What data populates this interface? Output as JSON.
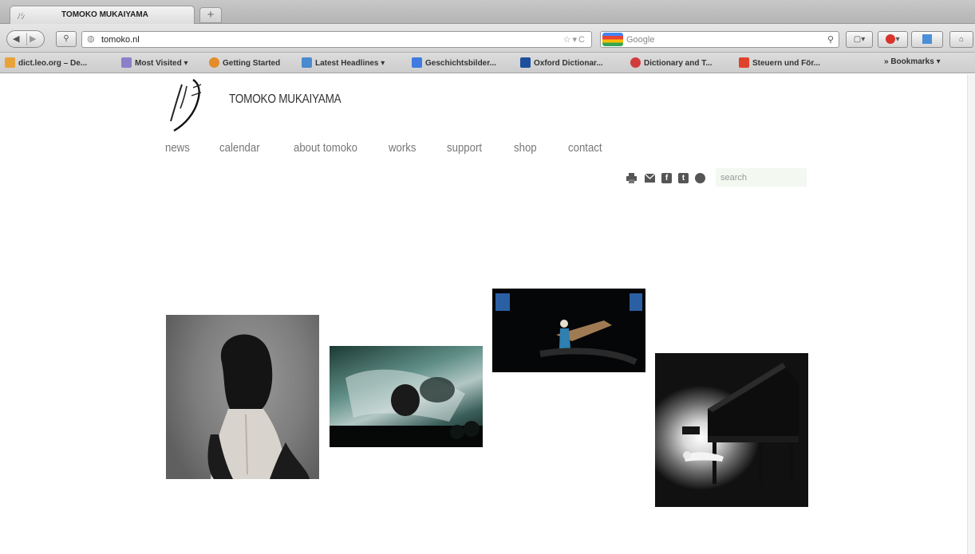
{
  "browser": {
    "tab_title": "TOMOKO MUKAIYAMA",
    "new_tab_symbol": "+",
    "url": "tomoko.nl",
    "search_engine": "Google",
    "bookmarks": [
      {
        "label": "dict.leo.org – De...",
        "color": "#e8a23a"
      },
      {
        "label": "Most Visited ▾",
        "color": "#8c7fc9"
      },
      {
        "label": "Getting Started",
        "color": "#e58b2a"
      },
      {
        "label": "Latest Headlines ▾",
        "color": "#4a8ad0"
      },
      {
        "label": "Geschichtsbilder...",
        "color": "#3f7be0"
      },
      {
        "label": "Oxford Dictionar...",
        "color": "#1e4f9c"
      },
      {
        "label": "Dictionary and T...",
        "color": "#d23b3b"
      },
      {
        "label": "Steuern und För...",
        "color": "#e0432b"
      },
      {
        "label": "» Bookmarks ▾",
        "color": "#555555"
      }
    ]
  },
  "site": {
    "title": "TOMOKO MUKAIYAMA",
    "menu": [
      "news",
      "calendar",
      "about tomoko",
      "works",
      "support",
      "shop",
      "contact"
    ],
    "search_placeholder": "search",
    "share_icons": [
      "print-icon",
      "mail-icon",
      "facebook-icon",
      "twitter-icon",
      "smiley-icon"
    ],
    "facebook_glyph": "f",
    "twitter_glyph": "t"
  },
  "gallery": [
    {
      "name": "photo-woman-back"
    },
    {
      "name": "photo-projection-performance"
    },
    {
      "name": "photo-stage-performer"
    },
    {
      "name": "photo-piano-spotlight"
    }
  ]
}
